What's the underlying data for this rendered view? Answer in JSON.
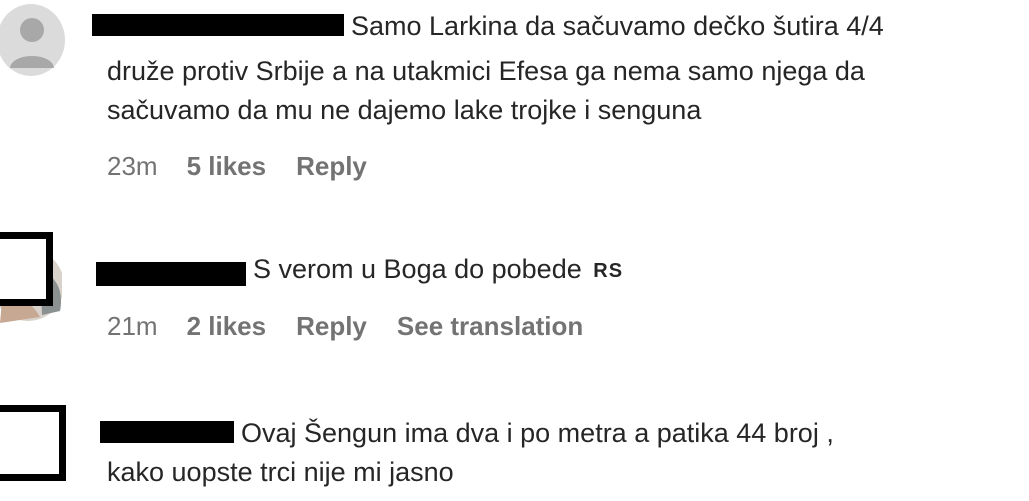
{
  "comments": [
    {
      "username": "",
      "lines": [
        "Samo Larkina da sačuvamo dečko šutira 4/4",
        "druže protiv Srbije a na utakmici Efesa ga nema samo njega da",
        "sačuvamo da mu ne dajemo lake trojke i senguna"
      ],
      "time": "23m",
      "likes": "5 likes",
      "reply": "Reply"
    },
    {
      "username": "",
      "lines": [
        "S verom u Boga do pobede"
      ],
      "flag": "RS",
      "time": "21m",
      "likes": "2 likes",
      "reply": "Reply",
      "see_translation": "See translation"
    },
    {
      "username": "",
      "lines": [
        "Ovaj Šengun ima dva i po metra a patika 44 broj ,",
        "kako uopste trci nije mi jasno"
      ]
    }
  ],
  "colors": {
    "text": "#262626",
    "meta": "#737373",
    "redaction": "#000000",
    "avatar_bg": "#dbdbdb",
    "avatar_fg": "#a8a8a8"
  },
  "icons": {
    "default_avatar": "person-silhouette-icon"
  }
}
